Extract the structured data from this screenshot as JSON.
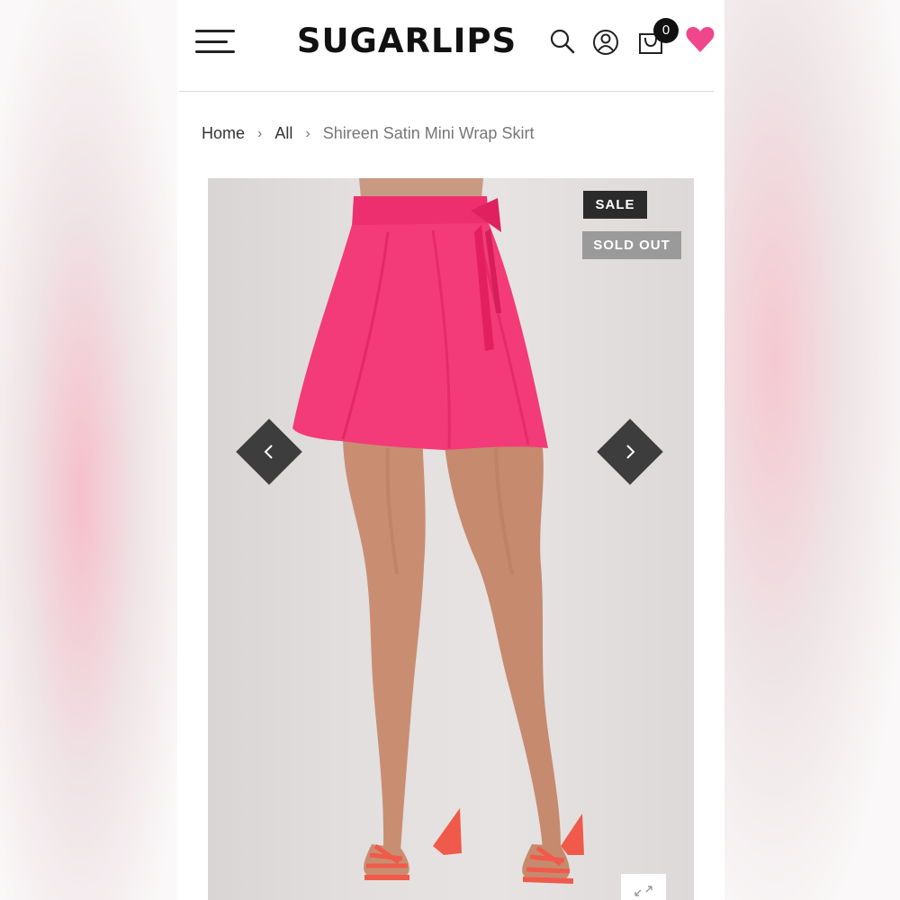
{
  "header": {
    "logo": "SUGARLIPS",
    "cart_count": "0",
    "icons": [
      "menu-icon",
      "search-icon",
      "account-icon",
      "cart-icon",
      "heart-icon"
    ],
    "heart_color": "#f0468c"
  },
  "breadcrumb": {
    "items": [
      "Home",
      "All"
    ],
    "current": "Shireen Satin Mini Wrap Skirt"
  },
  "product_gallery": {
    "badges": {
      "sale": "SALE",
      "sold_out": "SOLD OUT"
    },
    "image": "pink-satin-wrap-skirt-photo",
    "skirt_color": "#f0306e"
  }
}
